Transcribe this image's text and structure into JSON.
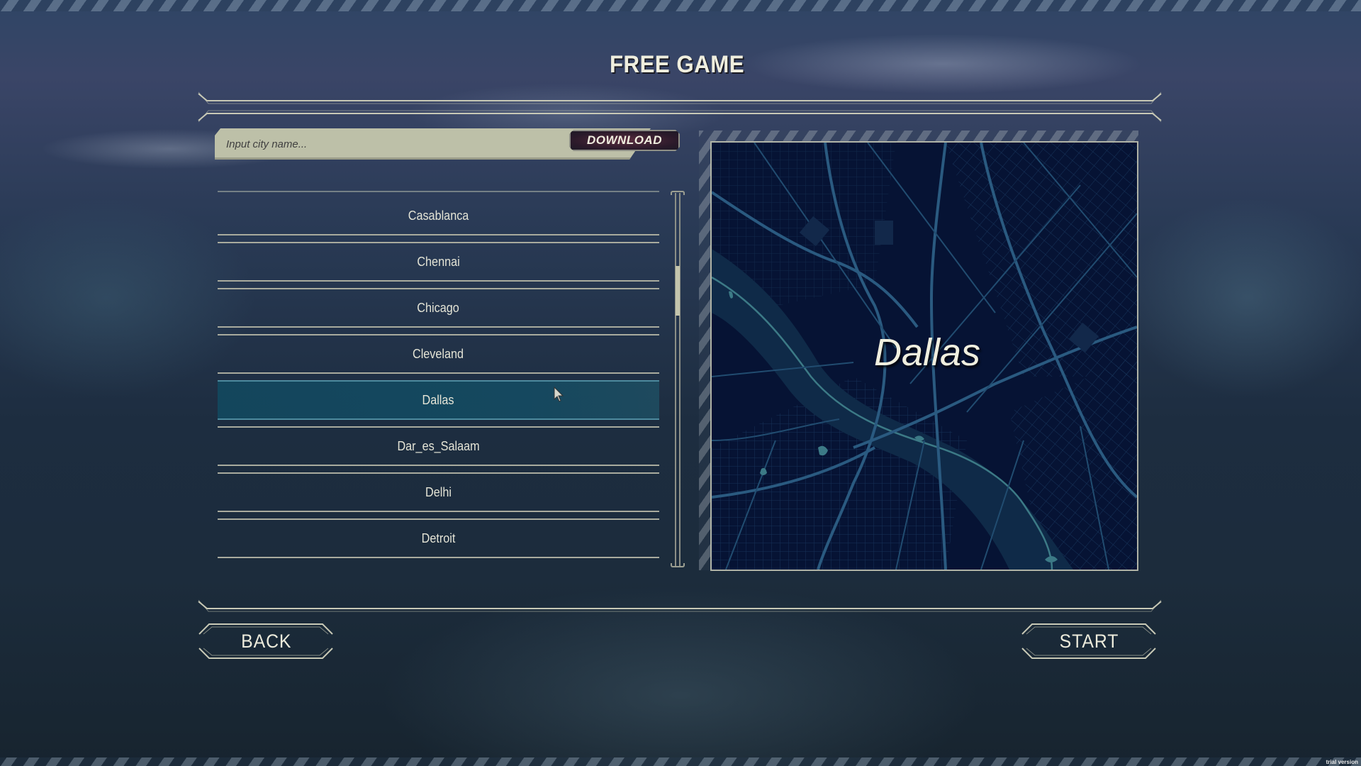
{
  "screen": {
    "title": "FREE GAME",
    "watermark": "trial version"
  },
  "search": {
    "placeholder": "Input city name...",
    "value": "",
    "download_label": "DOWNLOAD"
  },
  "city_list": {
    "items": [
      {
        "label": "Casablanca",
        "selected": false
      },
      {
        "label": "Chennai",
        "selected": false
      },
      {
        "label": "Chicago",
        "selected": false
      },
      {
        "label": "Cleveland",
        "selected": false
      },
      {
        "label": "Dallas",
        "selected": true
      },
      {
        "label": "Dar_es_Salaam",
        "selected": false
      },
      {
        "label": "Delhi",
        "selected": false
      },
      {
        "label": "Detroit",
        "selected": false
      }
    ],
    "scroll_position": 0.22
  },
  "preview": {
    "city_name": "Dallas",
    "colors": {
      "background": "#061334",
      "roads": "#2a5a80",
      "water": "#4a8a90",
      "river_bed": "#0f2a48"
    }
  },
  "footer": {
    "back_label": "BACK",
    "start_label": "START"
  },
  "icons": {
    "cursor": "mouse-pointer-icon"
  }
}
